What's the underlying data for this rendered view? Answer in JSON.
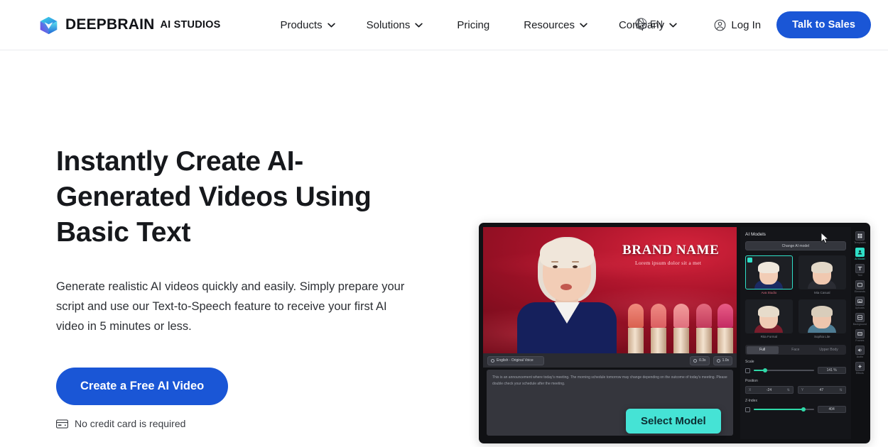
{
  "header": {
    "brand": {
      "name": "DEEPBRAIN",
      "sub": "AI STUDIOS",
      "logo_icon": "cube-logo-icon"
    },
    "nav": [
      {
        "label": "Products",
        "has_caret": true
      },
      {
        "label": "Solutions",
        "has_caret": true
      },
      {
        "label": "Pricing",
        "has_caret": false
      },
      {
        "label": "Resources",
        "has_caret": true
      },
      {
        "label": "Company",
        "has_caret": true
      }
    ],
    "language": {
      "code": "EN",
      "icon": "globe-icon"
    },
    "login": {
      "label": "Log In",
      "icon": "user-circle-icon"
    },
    "cta": {
      "label": "Talk to Sales"
    },
    "accent": "#1a56d6"
  },
  "hero": {
    "title": "Instantly Create AI-Generated Videos Using Basic Text",
    "description": "Generate realistic AI videos quickly and easily. Simply prepare your script and use our Text-to-Speech feature to receive your first AI video in 5 minutes or less.",
    "cta_label": "Create a Free AI Video",
    "note": "No credit card is required",
    "note_icon": "credit-card-icon"
  },
  "app": {
    "stage": {
      "brand_name": "BRAND NAME",
      "brand_tagline": "Lorem ipsum dolor sit a met"
    },
    "toolbar": {
      "voice_chip": "English - Original Voice",
      "duration_chip": "0.3s",
      "length_chip": "1.0s"
    },
    "script_text": "This is an announcement where today's meeting. The morning schedule tomorrow may change depending on the outcome of today's meeting. Please double check your schedule after the meeting.",
    "panel": {
      "title": "AI Models",
      "change_button": "Change AI model",
      "models": [
        {
          "label": "Ava Studio",
          "selected": true,
          "hair": "#efe7dc",
          "skin": "#f2cdb6",
          "body": "#1b2a63"
        },
        {
          "label": "Mia Casual",
          "selected": false,
          "hair": "#e3d8c8",
          "skin": "#f0c8b0",
          "body": "#2a2c33"
        },
        {
          "label": "Rita Formal",
          "selected": false,
          "hair": "#e7dccb",
          "skin": "#f1cbb4",
          "body": "#7a1d2c"
        },
        {
          "label": "Sophia Lite",
          "selected": false,
          "hair": "#d9cdbb",
          "skin": "#eec6ae",
          "body": "#4e7c93"
        }
      ],
      "tabs": [
        {
          "label": "Full",
          "active": true
        },
        {
          "label": "Face",
          "active": false
        },
        {
          "label": "Upper Body",
          "active": false
        }
      ],
      "scale": {
        "label": "Scale",
        "value": "141 %",
        "fill_percent": 18
      },
      "position": {
        "label": "Position",
        "x_axis": "X",
        "x_value": "-24",
        "y_axis": "Y",
        "y_value": "47"
      },
      "zindex": {
        "label": "Z-Index",
        "value": "404",
        "fill_percent": 82
      }
    },
    "rail": [
      {
        "label": "Templates",
        "icon": "templates-icon",
        "active": false
      },
      {
        "label": "AI Model",
        "icon": "ai-model-icon",
        "active": true
      },
      {
        "label": "Text",
        "icon": "text-icon",
        "active": false
      },
      {
        "label": "Elements",
        "icon": "elements-icon",
        "active": false
      },
      {
        "label": "Uploads",
        "icon": "uploads-icon",
        "active": false
      },
      {
        "label": "Background",
        "icon": "background-icon",
        "active": false
      },
      {
        "label": "Frames",
        "icon": "frames-icon",
        "active": false
      },
      {
        "label": "Audio",
        "icon": "audio-icon",
        "active": false
      },
      {
        "label": "Effects",
        "icon": "effects-icon",
        "active": false
      }
    ],
    "callout": {
      "label": "Select Model",
      "color": "#45e3d5"
    }
  }
}
